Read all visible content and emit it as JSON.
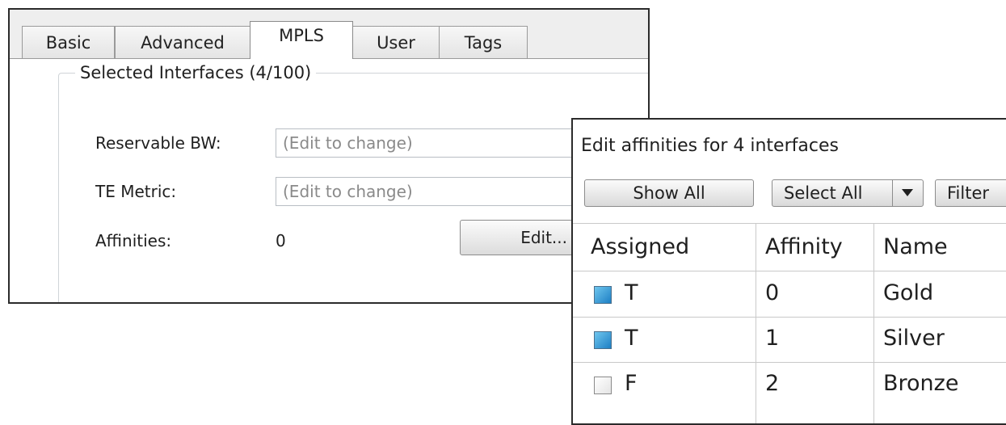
{
  "tabs": [
    {
      "label": "Basic",
      "active": false
    },
    {
      "label": "Advanced",
      "active": false
    },
    {
      "label": "MPLS",
      "active": true
    },
    {
      "label": "User",
      "active": false
    },
    {
      "label": "Tags",
      "active": false
    }
  ],
  "selected_group": {
    "title": "Selected Interfaces (4/100)",
    "reservable_bw_label": "Reservable BW:",
    "reservable_bw_placeholder": "(Edit to change)",
    "te_metric_label": "TE Metric:",
    "te_metric_placeholder": "(Edit to change)",
    "affinities_label": "Affinities:",
    "affinities_value": "0",
    "edit_button_label": "Edit..."
  },
  "affinity_dialog": {
    "title": "Edit affinities for 4 interfaces",
    "show_all_label": "Show All",
    "select_all_label": "Select All",
    "filter_label": "Filter",
    "columns": [
      "Assigned",
      "Affinity",
      "Name"
    ],
    "rows": [
      {
        "assigned": "T",
        "checked": true,
        "affinity": "0",
        "name": "Gold"
      },
      {
        "assigned": "T",
        "checked": true,
        "affinity": "1",
        "name": "Silver"
      },
      {
        "assigned": "F",
        "checked": false,
        "affinity": "2",
        "name": "Bronze"
      }
    ]
  },
  "colors": {
    "checkbox_checked": "#1d7fc4",
    "window_border": "#2b2b2b",
    "tab_strip_bg": "#eeeeee"
  }
}
